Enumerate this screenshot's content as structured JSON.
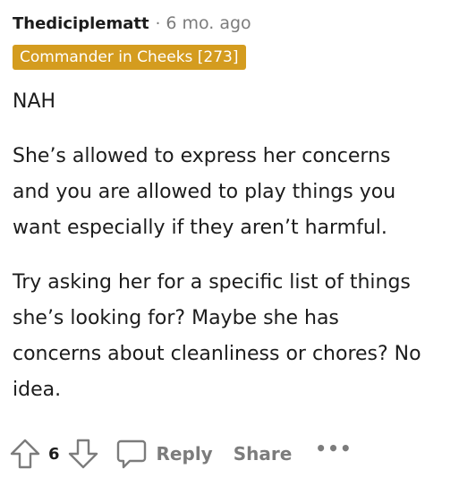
{
  "comment": {
    "author": "Thediciplematt",
    "separator": "·",
    "age": "6 mo. ago",
    "flair": "Commander in Cheeks [273]",
    "flair_color": "#d49c1f",
    "paragraphs": [
      "NAH",
      "She’s allowed to express her concerns\nand you are allowed to play things you\nwant especially if they aren’t harmful.",
      "Try asking her for a specific list of things\nshe’s looking for? Maybe she has\nconcerns about cleanliness or chores? No\nidea."
    ]
  },
  "actions": {
    "upvote_icon": "arrow-up-outline-icon",
    "vote_count": "6",
    "downvote_icon": "arrow-down-outline-icon",
    "reply_icon": "speech-bubble-icon",
    "reply_label": "Reply",
    "share_label": "Share",
    "more_label": "•••"
  },
  "colors": {
    "text": "#1c1c1c",
    "muted": "#7c7c7c",
    "flair_background": "#d49c1f"
  }
}
